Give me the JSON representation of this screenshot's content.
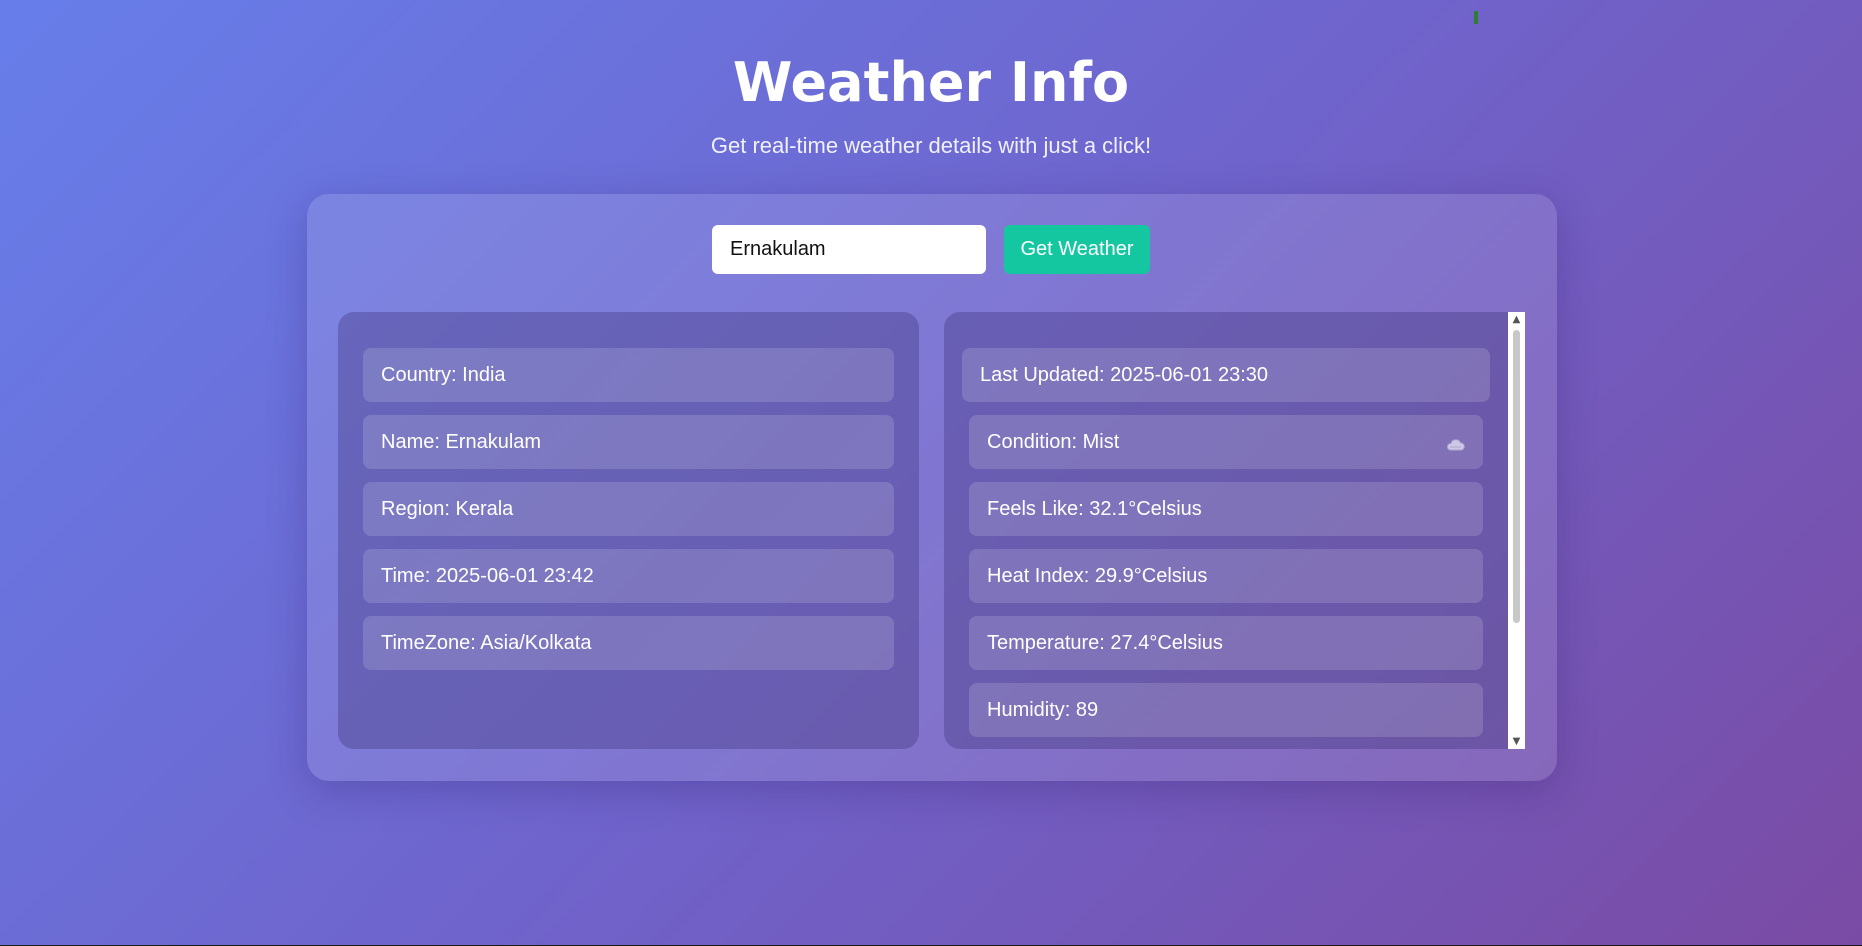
{
  "header": {
    "title": "Weather Info",
    "subtitle": "Get real-time weather details with just a click!"
  },
  "search": {
    "value": "Ernakulam",
    "placeholder": "",
    "button_label": "Get Weather"
  },
  "location": {
    "items": [
      "Country: India",
      "Name: Ernakulam",
      "Region: Kerala",
      "Time: 2025-06-01 23:42",
      "TimeZone: Asia/Kolkata"
    ]
  },
  "current": {
    "last_updated": "Last Updated: 2025-06-01 23:30",
    "condition": "Condition: Mist",
    "condition_icon": "cloud-icon",
    "feels_like": "Feels Like: 32.1°Celsius",
    "heat_index": "Heat Index: 29.9°Celsius",
    "temperature": "Temperature: 27.4°Celsius",
    "humidity": "Humidity: 89"
  },
  "colors": {
    "accent_button": "#14c7a0",
    "background_start": "#677eea",
    "background_end": "#7a4ba4"
  }
}
